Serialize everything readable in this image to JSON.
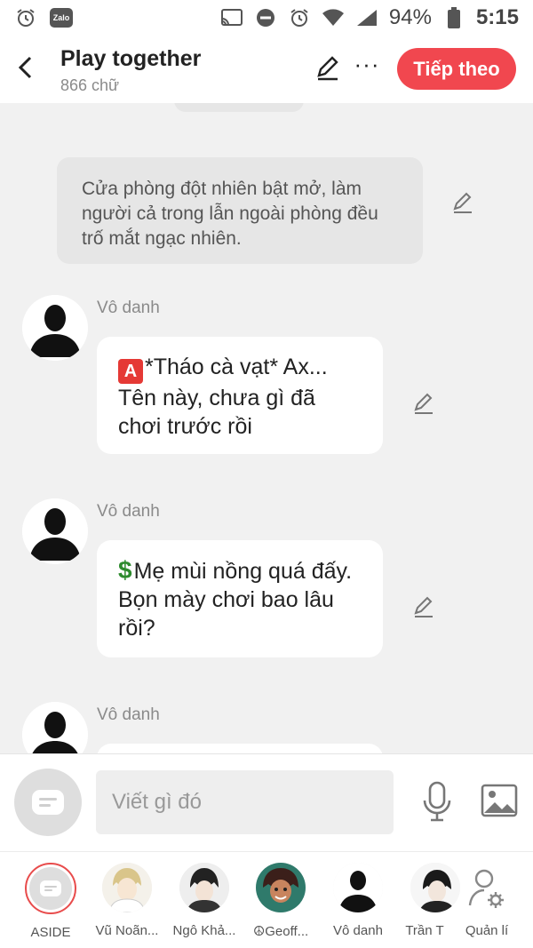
{
  "status_bar": {
    "battery": "94%",
    "time": "5:15",
    "left_icons": [
      "alarm-icon",
      "zalo-icon"
    ],
    "right_icons": [
      "cast-icon",
      "dnd-icon",
      "alarm-icon",
      "wifi-icon",
      "signal-icon",
      "battery-icon"
    ],
    "zalo_label": "Zalo"
  },
  "header": {
    "title": "Play together",
    "subtitle": "866 chữ",
    "next_label": "Tiếp theo",
    "more_label": "···",
    "accent": "#f1474f"
  },
  "chat": {
    "narration": "Cửa phòng đột nhiên bật mở, làm người cả trong lẫn ngoài phòng đều trố mắt ngạc nhiên.",
    "messages": [
      {
        "name": "Vô danh",
        "prefix": "A",
        "text": "*Tháo cà vạt* Ax... Tên này, chưa gì đã chơi trước rồi"
      },
      {
        "name": "Vô danh",
        "prefix": "$",
        "text": "Mẹ mùi nồng quá đấy. Bọn mày chơi bao lâu rồi?"
      },
      {
        "name": "Vô danh",
        "prefix": "",
        "text": ""
      }
    ]
  },
  "input": {
    "placeholder": "Viết gì đó"
  },
  "characters": [
    {
      "label": "ASIDE"
    },
    {
      "label": "Vũ Noãn..."
    },
    {
      "label": "Ngô Khả..."
    },
    {
      "label": "☮Geoff..."
    },
    {
      "label": "Vô danh"
    },
    {
      "label": "Trần T"
    },
    {
      "label": "Quản lí"
    }
  ]
}
